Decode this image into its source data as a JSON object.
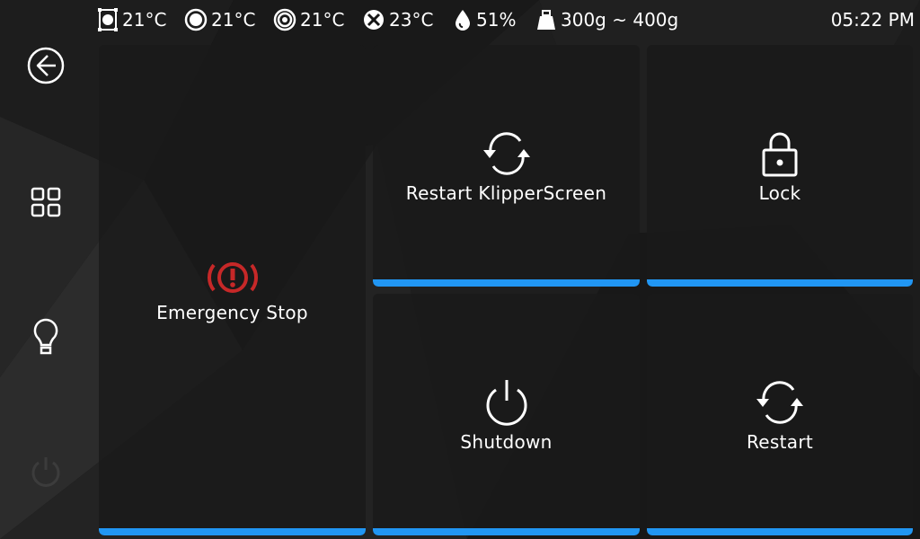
{
  "statusbar": {
    "items": [
      {
        "icon": "extruder-icon",
        "value": "21°C"
      },
      {
        "icon": "bed-icon",
        "value": "21°C"
      },
      {
        "icon": "chamber-icon",
        "value": "21°C"
      },
      {
        "icon": "fan-heater-icon",
        "value": "23°C"
      },
      {
        "icon": "humidity-icon",
        "value": "51%"
      },
      {
        "icon": "weight-icon",
        "value": "300g ~ 400g"
      }
    ],
    "time": "05:22 PM"
  },
  "sidebar": {
    "items": [
      {
        "icon": "back-arrow-icon"
      },
      {
        "icon": "grid-icon"
      },
      {
        "icon": "lightbulb-icon"
      },
      {
        "icon": "power-icon"
      }
    ]
  },
  "tiles": {
    "emergency": {
      "label": "Emergency Stop",
      "icon": "alert-icon",
      "color": "#c62828"
    },
    "restart_ks": {
      "label": "Restart KlipperScreen",
      "icon": "refresh-icon"
    },
    "lock": {
      "label": "Lock",
      "icon": "lock-icon"
    },
    "shutdown": {
      "label": "Shutdown",
      "icon": "power-icon"
    },
    "restart": {
      "label": "Restart",
      "icon": "refresh-icon"
    }
  },
  "colors": {
    "accent": "#2196f3",
    "danger": "#c62828",
    "background": "#161616"
  }
}
